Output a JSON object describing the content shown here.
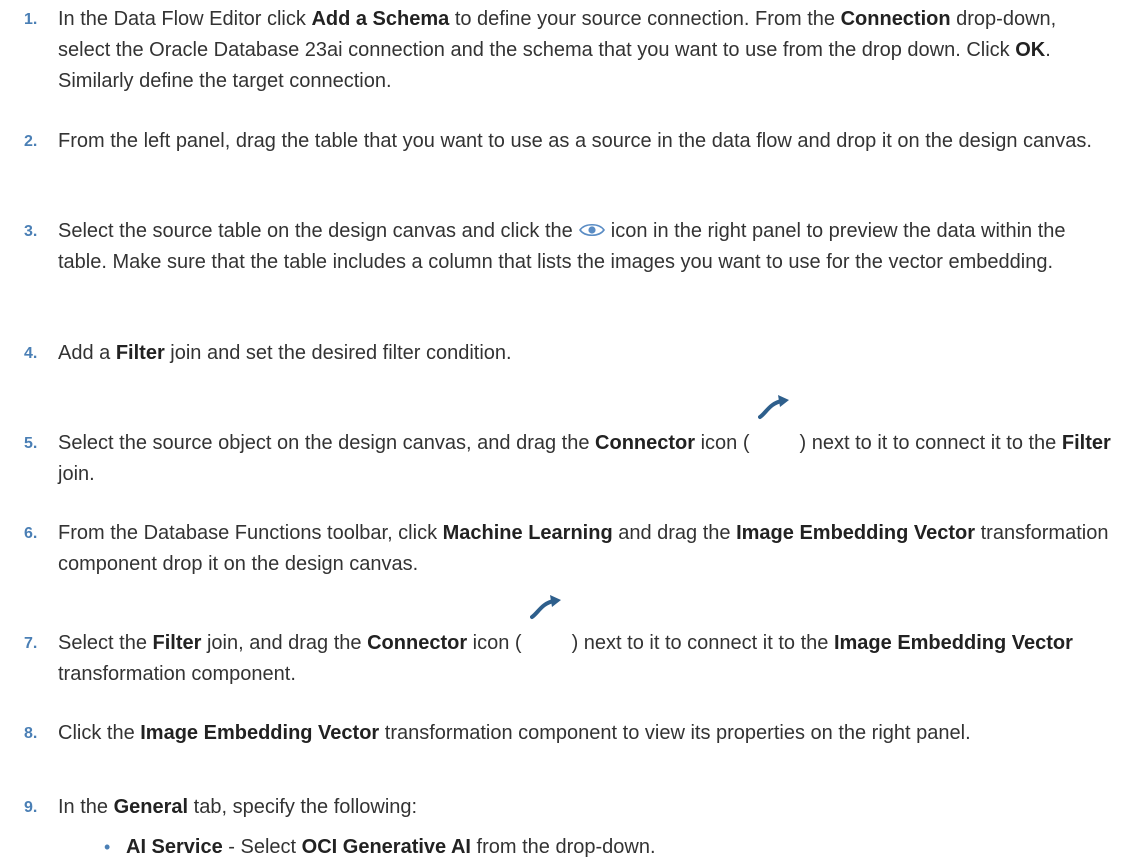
{
  "steps": [
    {
      "num": "1.",
      "parts": [
        {
          "t": "In the Data Flow Editor click "
        },
        {
          "b": "Add a Schema"
        },
        {
          "t": " to define your source connection. From the "
        },
        {
          "b": "Connection"
        },
        {
          "t": " drop-down, select the Oracle Database 23ai connection and the schema that you want to use from the drop down. Click "
        },
        {
          "b": "OK"
        },
        {
          "t": ". Similarly define the target connection."
        }
      ]
    },
    {
      "num": "2.",
      "parts": [
        {
          "t": "From the left panel, drag the table that you want to use as a source in the data flow and drop it on the design canvas."
        }
      ]
    },
    {
      "num": "3.",
      "parts": [
        {
          "t": "Select the source table on the design canvas and click the"
        },
        {
          "icon": "eye-icon"
        },
        {
          "t": "icon in the right panel to preview the data within the table. Make sure that the table includes a column that lists the images you want to use for the vector embedding."
        }
      ]
    },
    {
      "num": "4.",
      "parts": [
        {
          "t": "Add a "
        },
        {
          "b": "Filter"
        },
        {
          "t": " join and set the desired filter condition."
        }
      ]
    },
    {
      "num": "5.",
      "parts": [
        {
          "t": "Select the source object on the design canvas, and drag the "
        },
        {
          "b": "Connector"
        },
        {
          "t": " icon ("
        },
        {
          "icon": "connector-icon"
        },
        {
          "t": ") next to it to connect it to the "
        },
        {
          "b": "Filter"
        },
        {
          "t": " join."
        }
      ]
    },
    {
      "num": "6.",
      "parts": [
        {
          "t": "From the Database Functions toolbar, click "
        },
        {
          "b": "Machine Learning"
        },
        {
          "t": " and drag the "
        },
        {
          "b": "Image Embedding Vector"
        },
        {
          "t": " transformation component drop it on the design canvas."
        }
      ]
    },
    {
      "num": "7.",
      "parts": [
        {
          "t": "Select the "
        },
        {
          "b": "Filter"
        },
        {
          "t": " join, and drag the "
        },
        {
          "b": "Connector"
        },
        {
          "t": " icon ("
        },
        {
          "icon": "connector-icon"
        },
        {
          "t": ") next to it to connect it to the "
        },
        {
          "b": "Image Embedding Vector"
        },
        {
          "t": " transformation component."
        }
      ]
    },
    {
      "num": "8.",
      "parts": [
        {
          "t": "Click the "
        },
        {
          "b": "Image Embedding Vector"
        },
        {
          "t": " transformation component to view its properties on the right panel."
        }
      ]
    },
    {
      "num": "9.",
      "parts": [
        {
          "t": "In the "
        },
        {
          "b": "General"
        },
        {
          "t": " tab, specify the following:"
        }
      ]
    }
  ],
  "substeps": [
    {
      "bullet": "•",
      "parts": [
        {
          "b": "AI Service"
        },
        {
          "t": " - Select "
        },
        {
          "b": "OCI Generative AI"
        },
        {
          "t": " from the drop-down."
        }
      ]
    }
  ],
  "colors": {
    "number": "#4a7fb5",
    "text": "#333333"
  }
}
